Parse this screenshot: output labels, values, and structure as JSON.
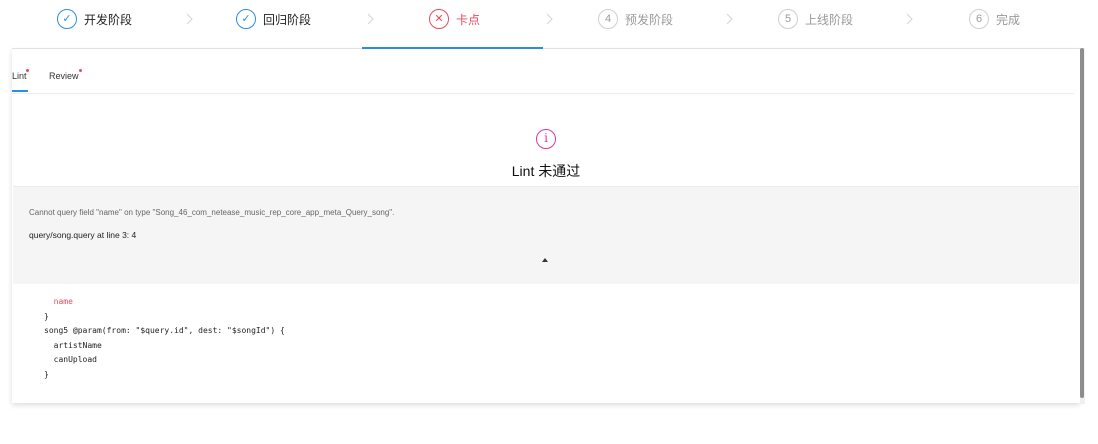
{
  "steps": [
    {
      "label": "开发阶段",
      "status": "done",
      "icon": "check-icon",
      "marker": "✓"
    },
    {
      "label": "回归阶段",
      "status": "done",
      "icon": "check-icon",
      "marker": "✓"
    },
    {
      "label": "卡点",
      "status": "error",
      "icon": "x-icon",
      "marker": "✕"
    },
    {
      "label": "预发阶段",
      "status": "wait",
      "icon": "",
      "marker": "4"
    },
    {
      "label": "上线阶段",
      "status": "wait",
      "icon": "",
      "marker": "5"
    },
    {
      "label": "完成",
      "status": "wait",
      "icon": "",
      "marker": "6"
    }
  ],
  "tabs": [
    {
      "label": "Lint",
      "active": true,
      "has_dot": true
    },
    {
      "label": "Review",
      "active": false,
      "has_dot": true
    }
  ],
  "result": {
    "icon": "info-icon",
    "icon_glyph": "i",
    "title": "Lint 未通过"
  },
  "error": {
    "message": "Cannot query field \"name\" on type \"Song_46_com_netease_music_rep_core_app_meta_Query_song\".",
    "location": "query/song.query at line 3: 4"
  },
  "code_lines": [
    {
      "text": "  name",
      "error": true
    },
    {
      "text": "}",
      "error": false
    },
    {
      "text": "song5 @param(from: \"$query.id\", dest: \"$songId\") {",
      "error": false
    },
    {
      "text": "  artistName",
      "error": false
    },
    {
      "text": "  canUpload",
      "error": false
    },
    {
      "text": "}",
      "error": false
    }
  ],
  "colors": {
    "primary": "#2b8fe0",
    "error": "#e84a5f",
    "info": "#e0359a"
  }
}
